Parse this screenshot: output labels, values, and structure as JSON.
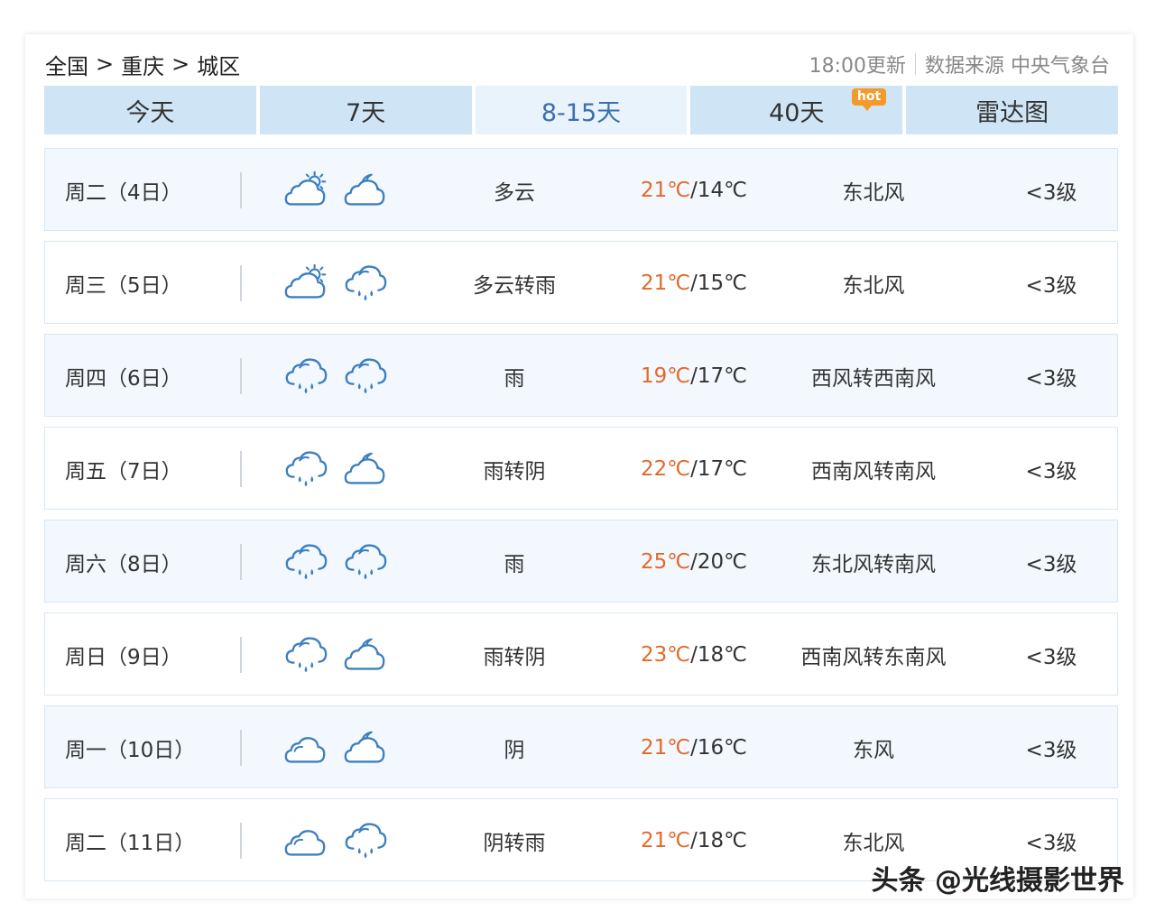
{
  "breadcrumb": {
    "country": "全国",
    "sep": ">",
    "city": "重庆",
    "district": "城区"
  },
  "header": {
    "update_time": "18:00更新",
    "source": "数据来源 中央气象台"
  },
  "tabs": [
    {
      "label": "今天"
    },
    {
      "label": "7天"
    },
    {
      "label": "8-15天",
      "active": true
    },
    {
      "label": "40天",
      "badge": "hot"
    },
    {
      "label": "雷达图"
    }
  ],
  "colors": {
    "accent": "#3a6fb2",
    "high_temp": "#e4682a",
    "tab_bg": "#cfe5f6",
    "row_bg": "#f2f8fd",
    "hot_badge": "#f39a2b"
  },
  "forecast": [
    {
      "date": "周二（4日）",
      "icon_day": "cloudy-sun-icon",
      "icon_night": "cloudy-moon-icon",
      "weather": "多云",
      "high": "21℃",
      "low": "14℃",
      "wind": "东北风",
      "level": "<3级"
    },
    {
      "date": "周三（5日）",
      "icon_day": "cloudy-sun-icon",
      "icon_night": "rain-icon",
      "weather": "多云转雨",
      "high": "21℃",
      "low": "15℃",
      "wind": "东北风",
      "level": "<3级"
    },
    {
      "date": "周四（6日）",
      "icon_day": "rain-icon",
      "icon_night": "rain-icon",
      "weather": "雨",
      "high": "19℃",
      "low": "17℃",
      "wind": "西风转西南风",
      "level": "<3级"
    },
    {
      "date": "周五（7日）",
      "icon_day": "rain-icon",
      "icon_night": "overcast-moon-icon",
      "weather": "雨转阴",
      "high": "22℃",
      "low": "17℃",
      "wind": "西南风转南风",
      "level": "<3级"
    },
    {
      "date": "周六（8日）",
      "icon_day": "rain-icon",
      "icon_night": "rain-icon",
      "weather": "雨",
      "high": "25℃",
      "low": "20℃",
      "wind": "东北风转南风",
      "level": "<3级"
    },
    {
      "date": "周日（9日）",
      "icon_day": "rain-icon",
      "icon_night": "overcast-moon-icon",
      "weather": "雨转阴",
      "high": "23℃",
      "low": "18℃",
      "wind": "西南风转东南风",
      "level": "<3级"
    },
    {
      "date": "周一（10日）",
      "icon_day": "overcast-icon",
      "icon_night": "overcast-moon-icon",
      "weather": "阴",
      "high": "21℃",
      "low": "16℃",
      "wind": "东风",
      "level": "<3级"
    },
    {
      "date": "周二（11日）",
      "icon_day": "overcast-icon",
      "icon_night": "rain-icon",
      "weather": "阴转雨",
      "high": "21℃",
      "low": "18℃",
      "wind": "东北风",
      "level": "<3级"
    }
  ],
  "watermark": "头条 @光线摄影世界"
}
